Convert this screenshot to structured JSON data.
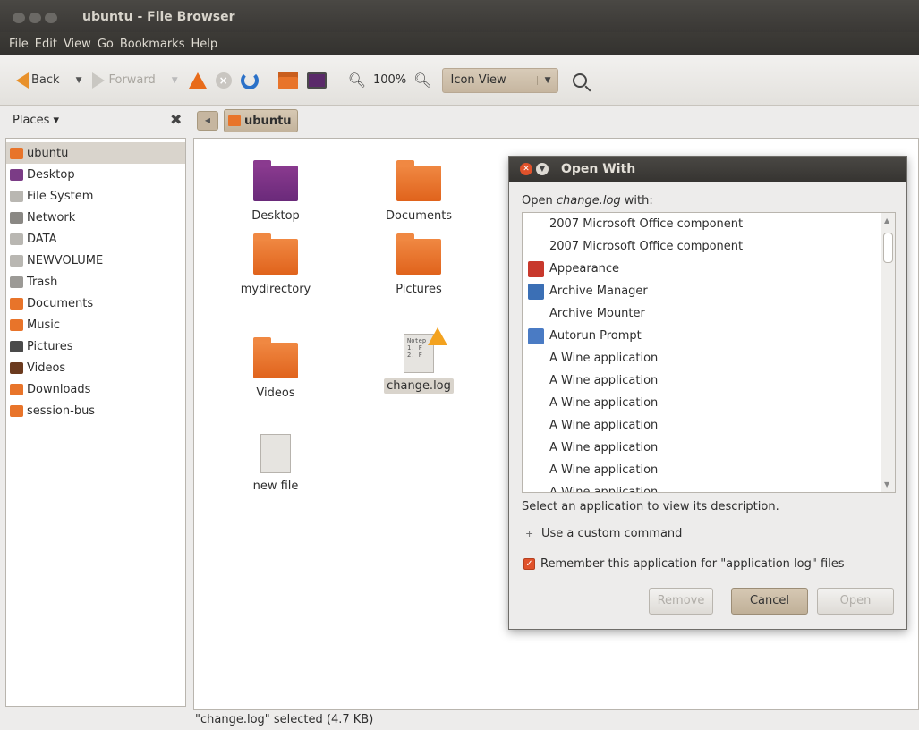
{
  "window": {
    "title": "ubuntu - File Browser",
    "menu": [
      "File",
      "Edit",
      "View",
      "Go",
      "Bookmarks",
      "Help"
    ]
  },
  "toolbar": {
    "back_label": "Back",
    "forward_label": "Forward",
    "zoom_level": "100%",
    "view_mode": "Icon View"
  },
  "sidebar": {
    "header": "Places ▾",
    "items": [
      {
        "label": "ubuntu",
        "icon": "home-folder-icon",
        "color": "#e8742a",
        "selected": true
      },
      {
        "label": "Desktop",
        "icon": "desktop-icon",
        "color": "#7b3c86"
      },
      {
        "label": "File System",
        "icon": "filesystem-icon",
        "color": "#b9b7b2"
      },
      {
        "label": "Network",
        "icon": "network-icon",
        "color": "#8a8884"
      },
      {
        "label": "DATA",
        "icon": "drive-icon",
        "color": "#b9b7b2"
      },
      {
        "label": "NEWVOLUME",
        "icon": "drive-icon",
        "color": "#b9b7b2"
      },
      {
        "label": "Trash",
        "icon": "trash-icon",
        "color": "#9c9a96"
      },
      {
        "label": "Documents",
        "icon": "documents-folder-icon",
        "color": "#e8742a"
      },
      {
        "label": "Music",
        "icon": "music-folder-icon",
        "color": "#e8742a"
      },
      {
        "label": "Pictures",
        "icon": "pictures-folder-icon",
        "color": "#4a4a4a"
      },
      {
        "label": "Videos",
        "icon": "videos-folder-icon",
        "color": "#6b3a1e"
      },
      {
        "label": "Downloads",
        "icon": "downloads-folder-icon",
        "color": "#e8742a"
      },
      {
        "label": "session-bus",
        "icon": "folder-icon",
        "color": "#e8742a"
      }
    ]
  },
  "path": {
    "current": "ubuntu"
  },
  "files": [
    {
      "label": "Desktop",
      "kind": "desktop-folder-icon"
    },
    {
      "label": "Documents",
      "kind": "documents-folder-icon"
    },
    {
      "label": "mydirectory",
      "kind": "folder-icon"
    },
    {
      "label": "Pictures",
      "kind": "pictures-folder-icon"
    },
    {
      "label": "Videos",
      "kind": "videos-folder-icon"
    },
    {
      "label": "change.log",
      "kind": "text-file-icon",
      "doc_text": "Notep\n1. F\n2. F",
      "selected": true
    },
    {
      "label": "new file",
      "kind": "locked-file-icon"
    }
  ],
  "status": "\"change.log\" selected (4.7 KB)",
  "dialog": {
    "title": "Open With",
    "prompt_pre": "Open ",
    "prompt_file": "change.log",
    "prompt_post": " with:",
    "apps": [
      {
        "label": "2007 Microsoft Office component",
        "icon": ""
      },
      {
        "label": "2007 Microsoft Office component",
        "icon": ""
      },
      {
        "label": "Appearance",
        "icon": "appearance-icon"
      },
      {
        "label": "Archive Manager",
        "icon": "archive-manager-icon"
      },
      {
        "label": "Archive Mounter",
        "icon": ""
      },
      {
        "label": "Autorun Prompt",
        "icon": "autorun-icon"
      },
      {
        "label": "A Wine application",
        "icon": ""
      },
      {
        "label": "A Wine application",
        "icon": ""
      },
      {
        "label": "A Wine application",
        "icon": ""
      },
      {
        "label": "A Wine application",
        "icon": ""
      },
      {
        "label": "A Wine application",
        "icon": ""
      },
      {
        "label": "A Wine application",
        "icon": ""
      },
      {
        "label": "A Wine application",
        "icon": ""
      }
    ],
    "description": "Select an application to view its description.",
    "custom_command": "Use a custom command",
    "remember": "Remember this application for \"application log\" files",
    "remember_checked": true,
    "buttons": {
      "remove": "Remove",
      "cancel": "Cancel",
      "open": "Open"
    }
  }
}
